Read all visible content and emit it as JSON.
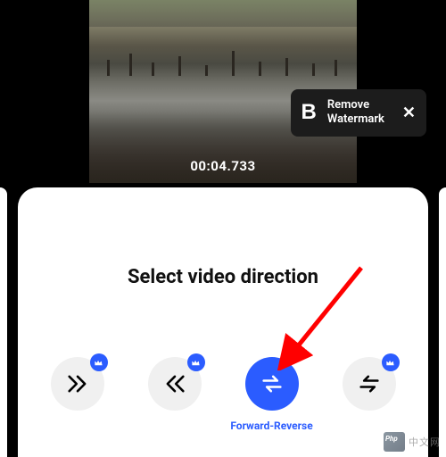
{
  "video": {
    "timestamp": "00:04.733"
  },
  "watermark_banner": {
    "logo_letter": "B",
    "line1": "Remove",
    "line2": "Watermark",
    "close": "✕"
  },
  "sheet": {
    "title": "Select video direction"
  },
  "options": [
    {
      "id": "forward",
      "label": "",
      "selected": false,
      "premium": true,
      "icon": "double-forward"
    },
    {
      "id": "reverse",
      "label": "",
      "selected": false,
      "premium": true,
      "icon": "double-backward"
    },
    {
      "id": "forward-reverse",
      "label": "Forward-Reverse",
      "selected": true,
      "premium": false,
      "icon": "swap"
    },
    {
      "id": "reverse-forward",
      "label": "",
      "selected": false,
      "premium": true,
      "icon": "swap"
    }
  ],
  "site_watermark": {
    "text": "中文网"
  },
  "colors": {
    "accent": "#2b5cff",
    "sheet_bg": "#ffffff",
    "page_bg": "#000000",
    "annotation": "#ff0000"
  }
}
